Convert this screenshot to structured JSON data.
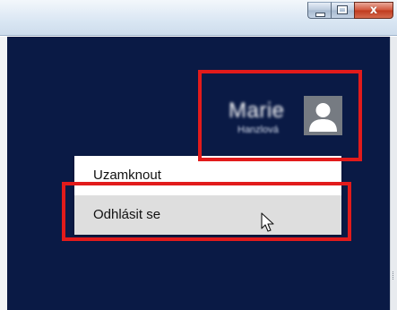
{
  "window": {
    "caption_buttons": [
      {
        "name": "minimize",
        "glyph": ""
      },
      {
        "name": "maximize",
        "glyph": ""
      },
      {
        "name": "close",
        "glyph": "x"
      }
    ]
  },
  "user_tile": {
    "name": "Marie",
    "subtitle": "Hanzlová",
    "avatar_icon": "user-silhouette-icon",
    "avatar_bg": "#767b82"
  },
  "menu": {
    "items": [
      {
        "label": "Uzamknout",
        "state": "normal"
      },
      {
        "label": "Odhlásit se",
        "state": "hover"
      }
    ]
  },
  "colors": {
    "background": "#0a1a45",
    "highlight": "#e21b1b",
    "menu_hover": "#dedede"
  }
}
